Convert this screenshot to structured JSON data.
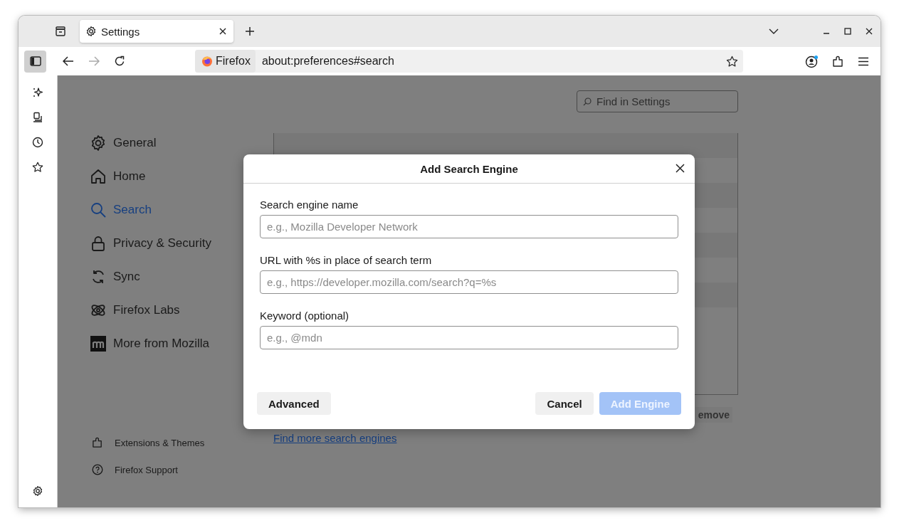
{
  "tabs": [
    {
      "label": "Settings",
      "selected": true
    }
  ],
  "toolbar": {
    "nav_buttons": [
      {
        "kind": "back",
        "disabled": false
      },
      {
        "kind": "forward",
        "disabled": true
      },
      {
        "kind": "reload",
        "disabled": false
      }
    ],
    "identity": "Firefox",
    "url": "about:preferences#search"
  },
  "sidebar_icons": [
    {
      "kind": "sparkle"
    },
    {
      "kind": "devices"
    },
    {
      "kind": "history"
    },
    {
      "kind": "bookmarks"
    }
  ],
  "settings": {
    "search": {
      "placeholder": "Find in Settings"
    },
    "nav": [
      {
        "kind": "general",
        "label": "General",
        "selected": false
      },
      {
        "kind": "home",
        "label": "Home",
        "selected": false
      },
      {
        "kind": "search",
        "label": "Search",
        "selected": true
      },
      {
        "kind": "privacy",
        "label": "Privacy & Security",
        "selected": false
      },
      {
        "kind": "sync",
        "label": "Sync",
        "selected": false
      },
      {
        "kind": "labs",
        "label": "Firefox Labs",
        "selected": false
      },
      {
        "kind": "mozilla",
        "label": "More from Mozilla",
        "selected": false
      }
    ],
    "footer": [
      {
        "kind": "extensions",
        "label": "Extensions & Themes"
      },
      {
        "kind": "support",
        "label": "Firefox Support"
      }
    ],
    "remove_button": "emove",
    "find_more_link": "Find more search engines"
  },
  "dialog": {
    "title": "Add Search Engine",
    "fields": [
      {
        "label": "Search engine name",
        "placeholder": "e.g., Mozilla Developer Network"
      },
      {
        "label": "URL with %s in place of search term",
        "placeholder": "e.g., https://developer.mozilla.com/search?q=%s"
      },
      {
        "label": "Keyword (optional)",
        "placeholder": "e.g., @mdn"
      }
    ],
    "buttons": [
      {
        "label": "Advanced",
        "kind": "secondary",
        "disabled": false
      },
      {
        "label": "Cancel",
        "kind": "secondary",
        "disabled": false
      },
      {
        "label": "Add Engine",
        "kind": "primary",
        "disabled": true
      }
    ]
  }
}
